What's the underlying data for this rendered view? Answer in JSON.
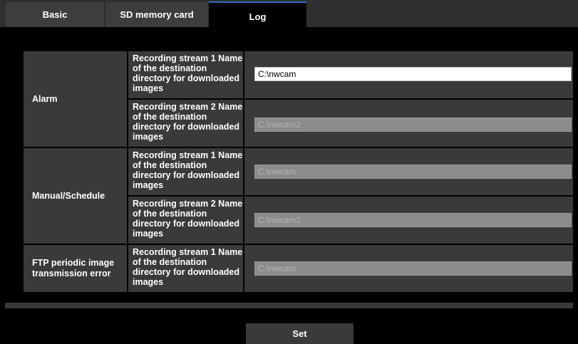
{
  "tabs": {
    "basic": "Basic",
    "sd_memory_card": "SD memory card",
    "log": "Log",
    "active": "Log"
  },
  "rows": {
    "alarm": {
      "label": "Alarm",
      "stream1": {
        "label": "Recording stream 1 Name of the destination directory for downloaded images",
        "value": "C:\\nwcam",
        "enabled": true
      },
      "stream2": {
        "label": "Recording stream 2 Name of the destination directory for downloaded images",
        "value": "C:\\nwcam2",
        "enabled": false
      }
    },
    "manual_schedule": {
      "label": "Manual/Schedule",
      "stream1": {
        "label": "Recording stream 1 Name of the destination directory for downloaded images",
        "value": "C:\\nwcam",
        "enabled": false
      },
      "stream2": {
        "label": "Recording stream 2 Name of the destination directory for downloaded images",
        "value": "C:\\nwcam2",
        "enabled": false
      }
    },
    "ftp": {
      "label": "FTP periodic image transmission error",
      "stream1": {
        "label": "Recording stream 1 Name of the destination directory for downloaded images",
        "value": "C:\\nwcam",
        "enabled": false
      }
    }
  },
  "set_button": "Set",
  "colors": {
    "accent": "#2b6cc4",
    "cell_bg": "#3a3a3a",
    "disabled_input": "#8c8c8c"
  }
}
